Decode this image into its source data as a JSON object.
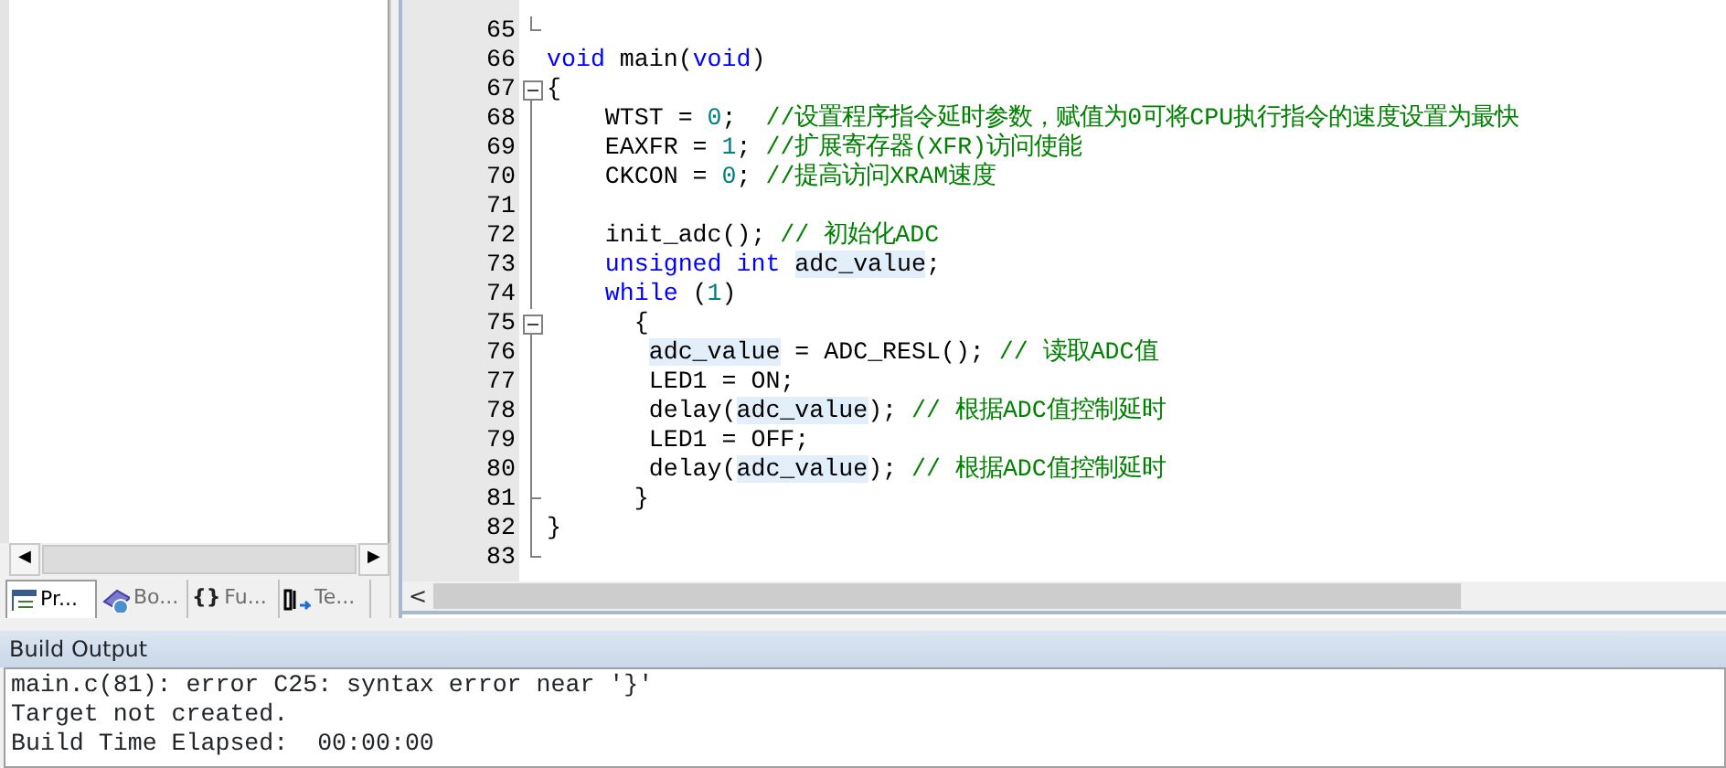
{
  "project_panel": {
    "scrollbar": {
      "left_arrow": "◀",
      "right_arrow": "▶"
    },
    "tabs": [
      {
        "label": "Pr...",
        "kind": "project",
        "selected": true
      },
      {
        "label": "Bo...",
        "kind": "books",
        "selected": false
      },
      {
        "label": "Fu...",
        "kind": "functions",
        "glyph": "{}",
        "selected": false
      },
      {
        "label": "Te...",
        "kind": "templates",
        "selected": false
      }
    ]
  },
  "editor": {
    "lines": [
      {
        "number": "65",
        "kind": "fold-end"
      },
      {
        "number": "66",
        "kind": "plain",
        "tokens": [
          {
            "kind": "keyword",
            "text": "void"
          },
          {
            "kind": "plain",
            "text": " main("
          },
          {
            "kind": "keyword",
            "text": "void"
          },
          {
            "kind": "plain",
            "text": ")"
          }
        ]
      },
      {
        "number": "67",
        "kind": "fold-start",
        "tokens": [
          {
            "kind": "plain",
            "text": "{"
          }
        ]
      },
      {
        "number": "68",
        "kind": "fold-line",
        "tokens": [
          {
            "kind": "plain",
            "text": "    WTST = "
          },
          {
            "kind": "number",
            "text": "0"
          },
          {
            "kind": "plain",
            "text": ";  "
          },
          {
            "kind": "comment",
            "text": "//设置程序指令延时参数，赋值为0可将CPU执行指令的速度设置为最快"
          }
        ]
      },
      {
        "number": "69",
        "kind": "fold-line",
        "tokens": [
          {
            "kind": "plain",
            "text": "    EAXFR = "
          },
          {
            "kind": "number",
            "text": "1"
          },
          {
            "kind": "plain",
            "text": "; "
          },
          {
            "kind": "comment",
            "text": "//扩展寄存器(XFR)访问使能"
          }
        ]
      },
      {
        "number": "70",
        "kind": "fold-line",
        "tokens": [
          {
            "kind": "plain",
            "text": "    CKCON = "
          },
          {
            "kind": "number",
            "text": "0"
          },
          {
            "kind": "plain",
            "text": "; "
          },
          {
            "kind": "comment",
            "text": "//提高访问XRAM速度"
          }
        ]
      },
      {
        "number": "71",
        "kind": "fold-line"
      },
      {
        "number": "72",
        "kind": "fold-line",
        "tokens": [
          {
            "kind": "plain",
            "text": "    init_adc(); "
          },
          {
            "kind": "comment",
            "text": "// 初始化ADC"
          }
        ]
      },
      {
        "number": "73",
        "kind": "fold-line",
        "tokens": [
          {
            "kind": "keyword",
            "text": "    unsigned int"
          },
          {
            "kind": "highlight",
            "text": " adc_value"
          },
          {
            "kind": "plain",
            "text": ";"
          }
        ]
      },
      {
        "number": "74",
        "kind": "fold-line",
        "tokens": [
          {
            "kind": "keyword",
            "text": "    while"
          },
          {
            "kind": "plain",
            "text": " ("
          },
          {
            "kind": "number",
            "text": "1"
          },
          {
            "kind": "plain",
            "text": ")"
          }
        ]
      },
      {
        "number": "75",
        "kind": "fold-start",
        "tokens": [
          {
            "kind": "plain",
            "text": "      {"
          }
        ]
      },
      {
        "number": "76",
        "kind": "fold-line",
        "tokens": [
          {
            "kind": "highlight",
            "text": "       adc_value"
          },
          {
            "kind": "plain",
            "text": " = ADC_RESL(); "
          },
          {
            "kind": "comment",
            "text": "// 读取ADC值"
          }
        ]
      },
      {
        "number": "77",
        "kind": "fold-line",
        "tokens": [
          {
            "kind": "plain",
            "text": "       LED1 = ON;"
          }
        ]
      },
      {
        "number": "78",
        "kind": "fold-line",
        "tokens": [
          {
            "kind": "plain",
            "text": "       delay("
          },
          {
            "kind": "highlight",
            "text": "adc_value"
          },
          {
            "kind": "plain",
            "text": "); "
          },
          {
            "kind": "comment",
            "text": "// 根据ADC值控制延时"
          }
        ]
      },
      {
        "number": "79",
        "kind": "fold-line",
        "tokens": [
          {
            "kind": "plain",
            "text": "       LED1 = OFF;"
          }
        ]
      },
      {
        "number": "80",
        "kind": "fold-line",
        "tokens": [
          {
            "kind": "plain",
            "text": "       delay("
          },
          {
            "kind": "highlight",
            "text": "adc_value"
          },
          {
            "kind": "plain",
            "text": "); "
          },
          {
            "kind": "comment",
            "text": "// 根据ADC值控制延时"
          }
        ]
      },
      {
        "number": "81",
        "kind": "fold-end-inner",
        "tokens": [
          {
            "kind": "plain",
            "text": "      }"
          }
        ]
      },
      {
        "number": "82",
        "kind": "fold-line",
        "tokens": [
          {
            "kind": "plain",
            "text": "}"
          }
        ]
      },
      {
        "number": "83",
        "kind": "fold-end"
      }
    ],
    "scrollbar": {
      "left_arrow": "<"
    }
  },
  "build_output": {
    "title": "Build Output",
    "lines": [
      "main.c(81): error C25: syntax error near '}'",
      "Target not created.",
      "Build Time Elapsed:  00:00:00"
    ]
  }
}
